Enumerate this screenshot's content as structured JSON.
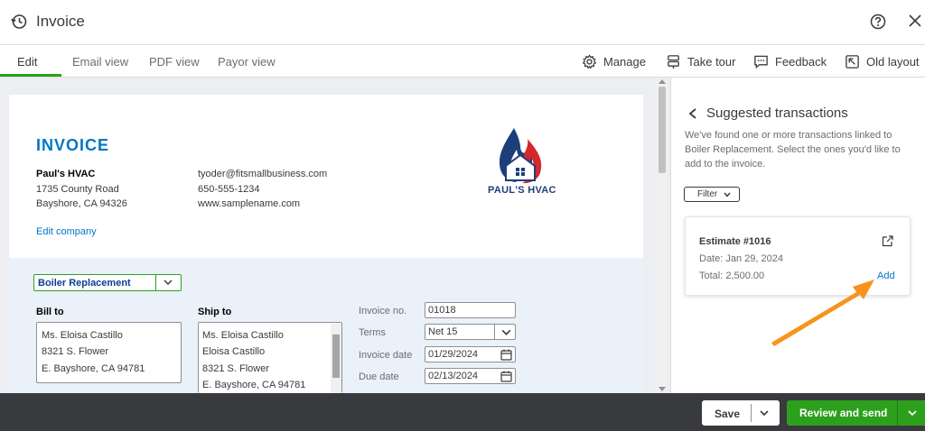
{
  "window": {
    "title": "Invoice"
  },
  "tabs": [
    {
      "label": "Edit",
      "active": true
    },
    {
      "label": "Email view"
    },
    {
      "label": "PDF view"
    },
    {
      "label": "Payor view"
    }
  ],
  "toolbar": {
    "manage": "Manage",
    "take_tour": "Take tour",
    "feedback": "Feedback",
    "old_layout": "Old layout"
  },
  "invoice": {
    "heading": "INVOICE",
    "company_name": "Paul's HVAC",
    "address1": "1735 County Road",
    "address2": "Bayshore, CA 94326",
    "email": "tyoder@fitsmallbusiness.com",
    "phone": "650-555-1234",
    "website": "www.samplename.com",
    "edit_company": "Edit company",
    "logo_text": "PAUL'S HVAC",
    "customer": "Boiler Replacement",
    "bill_to_label": "Bill to",
    "bill_to": [
      "Ms. Eloisa Castillo",
      "8321 S. Flower",
      "E. Bayshore, CA  94781"
    ],
    "ship_to_label": "Ship to",
    "ship_to": [
      "Ms. Eloisa Castillo",
      "Eloisa Castillo",
      "8321 S. Flower",
      "E. Bayshore, CA  94781"
    ],
    "invoice_no_label": "Invoice no.",
    "invoice_no": "01018",
    "terms_label": "Terms",
    "terms": "Net 15",
    "invoice_date_label": "Invoice date",
    "invoice_date": "01/29/2024",
    "due_date_label": "Due date",
    "due_date": "02/13/2024"
  },
  "panel": {
    "title": "Suggested transactions",
    "desc_lines": [
      "We've found one or more transactions linked to",
      "Boiler Replacement. Select the ones you'd like to",
      "add to the invoice."
    ],
    "filter": "Filter",
    "card": {
      "title": "Estimate #1016",
      "date": "Date:   Jan 29, 2024",
      "total": "Total:   2,500.00",
      "add": "Add"
    }
  },
  "footer": {
    "save": "Save",
    "review_send": "Review and send"
  },
  "colors": {
    "accent_green": "#2ca01c",
    "link_blue": "#0077c5",
    "annotation_orange": "#f7941d",
    "footer_dark": "#393a3d"
  }
}
